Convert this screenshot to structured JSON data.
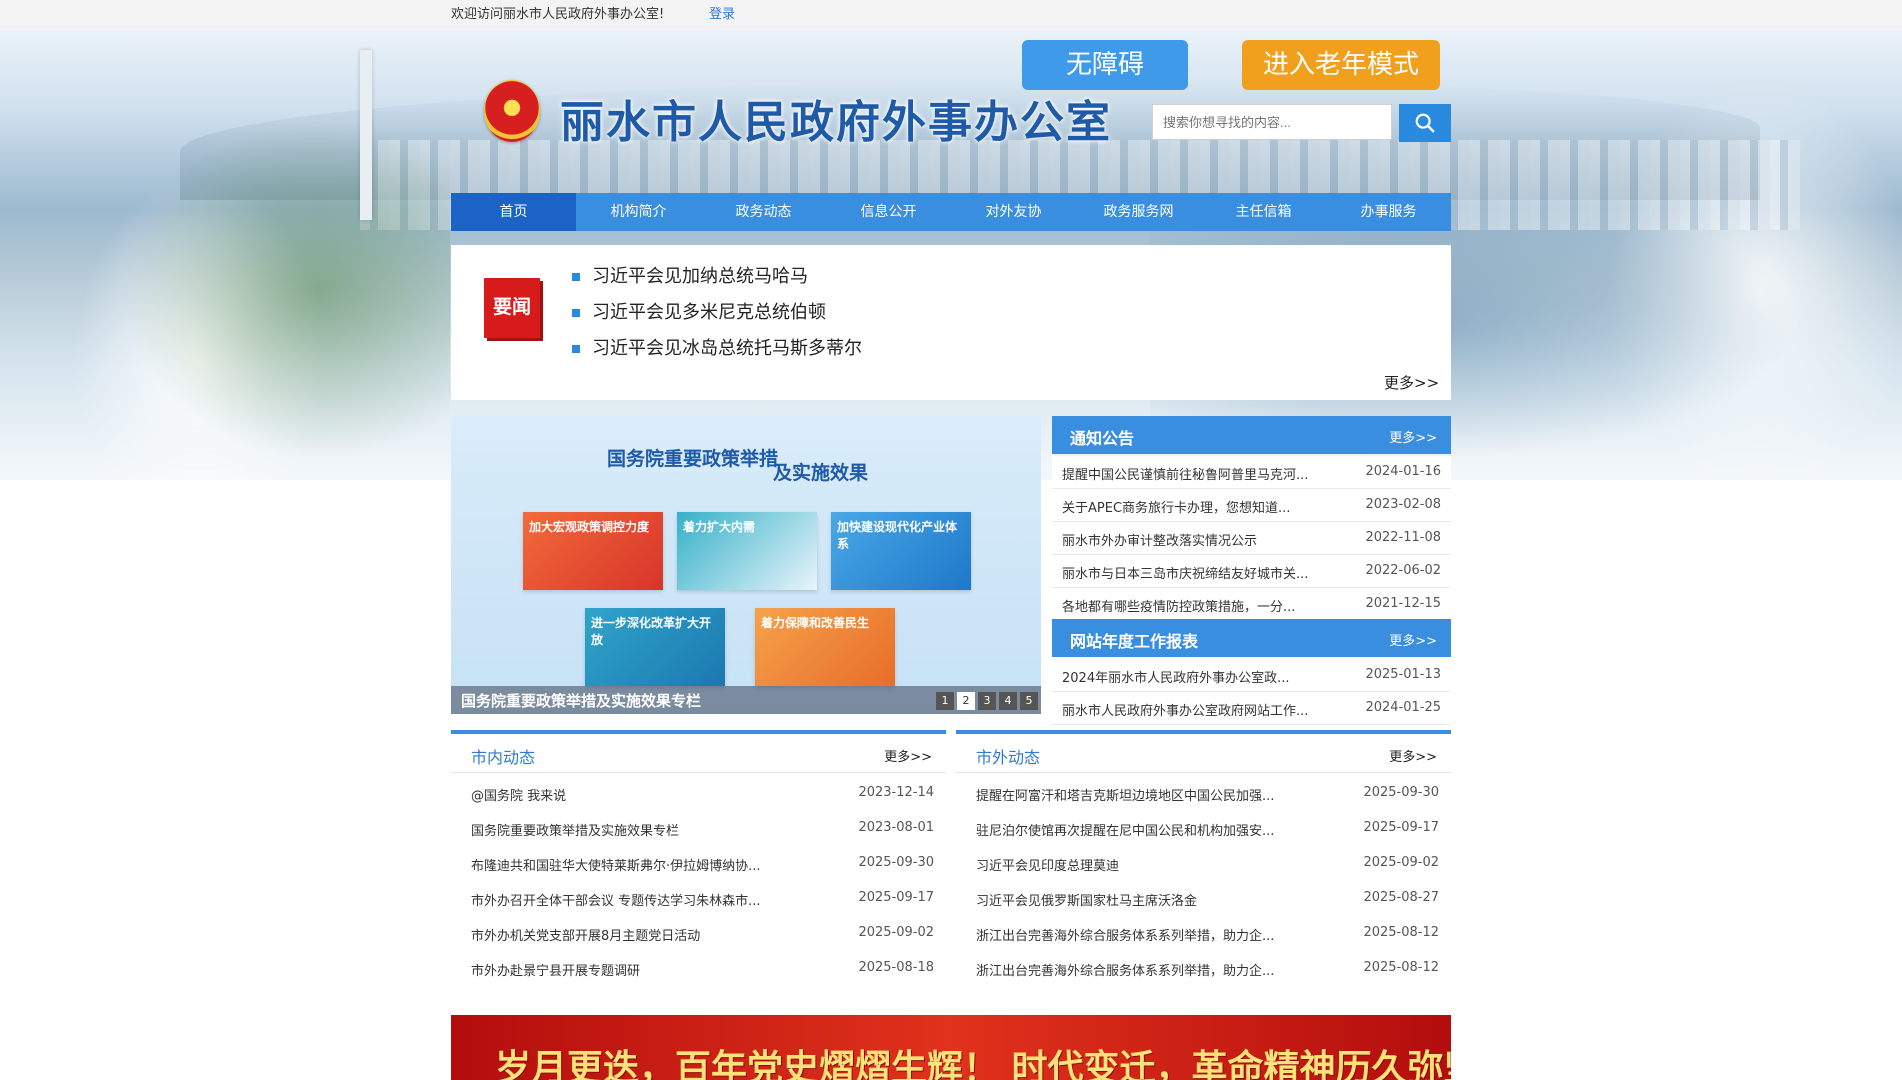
{
  "topbar": {
    "welcome": "欢迎访问丽水市人民政府外事办公室!",
    "login": "登录"
  },
  "header": {
    "site_title": "丽水市人民政府外事办公室",
    "accessibility_btn": "无障碍",
    "elder_mode_btn": "进入老年模式",
    "search_placeholder": "搜索你想寻找的内容..."
  },
  "nav": {
    "items": [
      {
        "label": "首页"
      },
      {
        "label": "机构简介"
      },
      {
        "label": "政务动态"
      },
      {
        "label": "信息公开"
      },
      {
        "label": "对外友协"
      },
      {
        "label": "政务服务网"
      },
      {
        "label": "主任信箱"
      },
      {
        "label": "办事服务"
      }
    ]
  },
  "headline_news": {
    "badge": "要闻",
    "items": [
      "习近平会见加纳总统马哈马",
      "习近平会见多米尼克总统伯顿",
      "习近平会见冰岛总统托马斯多蒂尔"
    ],
    "more": "更多>>"
  },
  "carousel": {
    "title_line1": "国务院重要政策举措",
    "title_line2": "及实施效果",
    "tiles": [
      "加大宏观政策调控力度",
      "着力扩大内需",
      "加快建设现代化产业体系",
      "进一步深化改革扩大开放",
      "着力保障和改善民生"
    ],
    "caption": "国务院重要政策举措及实施效果专栏",
    "pages": [
      "1",
      "2",
      "3",
      "4",
      "5"
    ],
    "active_page": "2"
  },
  "notices": {
    "title": "通知公告",
    "more": "更多>>",
    "items": [
      {
        "title": "提醒中国公民谨慎前往秘鲁阿普里马克河...",
        "date": "2024-01-16"
      },
      {
        "title": "关于APEC商务旅行卡办理，您想知道...",
        "date": "2023-02-08"
      },
      {
        "title": "丽水市外办审计整改落实情况公示",
        "date": "2022-11-08"
      },
      {
        "title": "丽水市与日本三岛市庆祝缔结友好城市关...",
        "date": "2022-06-02"
      },
      {
        "title": "各地都有哪些疫情防控政策措施，一分...",
        "date": "2021-12-15"
      }
    ]
  },
  "annual_report": {
    "title": "网站年度工作报表",
    "more": "更多>>",
    "items": [
      {
        "title": "2024年丽水市人民政府外事办公室政...",
        "date": "2025-01-13"
      },
      {
        "title": "丽水市人民政府外事办公室政府网站工作...",
        "date": "2024-01-25"
      }
    ]
  },
  "city_news": {
    "title": "市内动态",
    "more": "更多>>",
    "items": [
      {
        "title": "@国务院 我来说",
        "date": "2023-12-14"
      },
      {
        "title": "国务院重要政策举措及实施效果专栏",
        "date": "2023-08-01"
      },
      {
        "title": "布隆迪共和国驻华大使特莱斯弗尔·伊拉姆博纳协...",
        "date": "2025-09-30"
      },
      {
        "title": "市外办召开全体干部会议 专题传达学习朱林森市...",
        "date": "2025-09-17"
      },
      {
        "title": "市外办机关党支部开展8月主题党日活动",
        "date": "2025-09-02"
      },
      {
        "title": "市外办赴景宁县开展专题调研",
        "date": "2025-08-18"
      }
    ]
  },
  "foreign_news": {
    "title": "市外动态",
    "more": "更多>>",
    "items": [
      {
        "title": "提醒在阿富汗和塔吉克斯坦边境地区中国公民加强...",
        "date": "2025-09-30"
      },
      {
        "title": "驻尼泊尔使馆再次提醒在尼中国公民和机构加强安...",
        "date": "2025-09-17"
      },
      {
        "title": "习近平会见印度总理莫迪",
        "date": "2025-09-02"
      },
      {
        "title": "习近平会见俄罗斯国家杜马主席沃洛金",
        "date": "2025-08-27"
      },
      {
        "title": "浙江出台完善海外综合服务体系系列举措，助力企...",
        "date": "2025-08-12"
      },
      {
        "title": "浙江出台完善海外综合服务体系系列举措，助力企...",
        "date": "2025-08-12"
      }
    ]
  },
  "banner": {
    "text": "岁月更迭，百年党史熠熠生辉！ 时代变迁，革命精神历久弥坚！"
  }
}
